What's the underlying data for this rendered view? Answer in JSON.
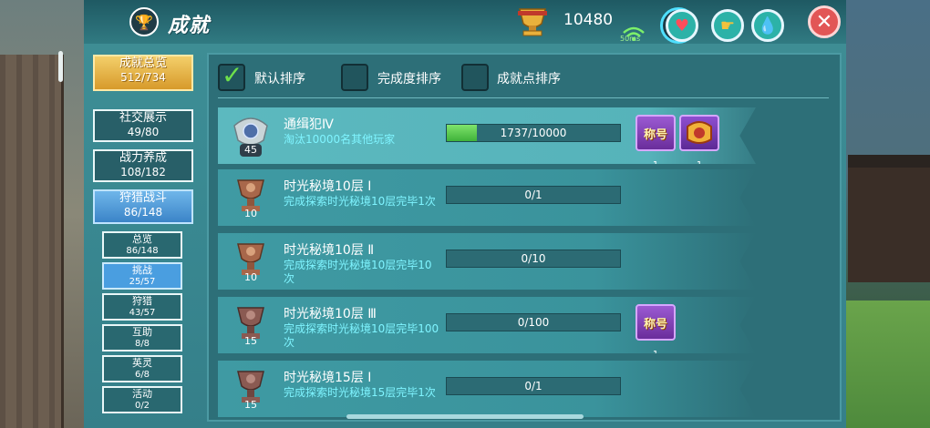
{
  "header": {
    "title": "成就",
    "points": "10480",
    "ping": "50ms",
    "icons": [
      "trophy-icon",
      "heart-icon",
      "strength-icon",
      "water-drop-icon",
      "close-icon"
    ]
  },
  "sidebar": {
    "categories": [
      {
        "label": "成就总览",
        "count": "512/734",
        "style": "gold"
      },
      {
        "label": "社交展示",
        "count": "49/80",
        "style": "normal"
      },
      {
        "label": "战力养成",
        "count": "108/182",
        "style": "normal"
      },
      {
        "label": "狩猎战斗",
        "count": "86/148",
        "style": "blue"
      }
    ],
    "subcategories": [
      {
        "label": "总览",
        "count": "86/148",
        "active": false
      },
      {
        "label": "挑战",
        "count": "25/57",
        "active": true
      },
      {
        "label": "狩猎",
        "count": "43/57",
        "active": false
      },
      {
        "label": "互助",
        "count": "8/8",
        "active": false
      },
      {
        "label": "英灵",
        "count": "6/8",
        "active": false
      },
      {
        "label": "活动",
        "count": "0/2",
        "active": false
      }
    ]
  },
  "sort": {
    "options": [
      {
        "label": "默认排序",
        "checked": true
      },
      {
        "label": "完成度排序",
        "checked": false
      },
      {
        "label": "成就点排序",
        "checked": false
      }
    ]
  },
  "achievements": [
    {
      "title": "通缉犯Ⅳ",
      "desc": "淘汰10000名其他玩家",
      "badge_number": "45",
      "progress_text": "1737/10000",
      "progress": 0.1737,
      "rewards": [
        {
          "label": "称号",
          "count": "1",
          "kind": "title"
        },
        {
          "label": "",
          "count": "1",
          "kind": "frame"
        }
      ]
    },
    {
      "title": "时光秘境10层 Ⅰ",
      "desc": "完成探索时光秘境10层完毕1次",
      "badge_number": "10",
      "progress_text": "0/1",
      "progress": 0,
      "rewards": []
    },
    {
      "title": "时光秘境10层 Ⅱ",
      "desc": "完成探索时光秘境10层完毕10次",
      "badge_number": "10",
      "progress_text": "0/10",
      "progress": 0,
      "rewards": []
    },
    {
      "title": "时光秘境10层 Ⅲ",
      "desc": "完成探索时光秘境10层完毕100次",
      "badge_number": "15",
      "progress_text": "0/100",
      "progress": 0,
      "rewards": [
        {
          "label": "称号",
          "count": "1",
          "kind": "title"
        }
      ]
    },
    {
      "title": "时光秘境15层 Ⅰ",
      "desc": "完成探索时光秘境15层完毕1次",
      "badge_number": "15",
      "progress_text": "0/1",
      "progress": 0,
      "rewards": []
    }
  ]
}
